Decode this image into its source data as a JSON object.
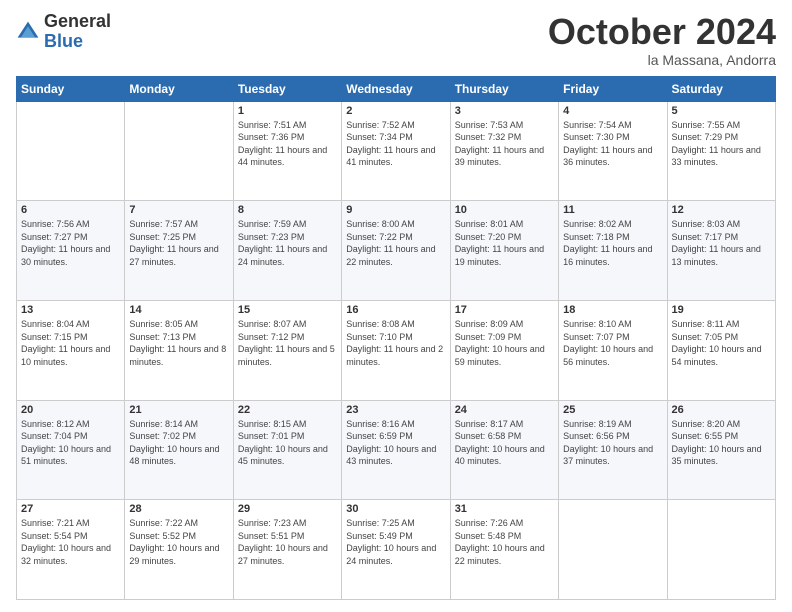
{
  "header": {
    "logo_general": "General",
    "logo_blue": "Blue",
    "month_title": "October 2024",
    "location": "la Massana, Andorra"
  },
  "days_of_week": [
    "Sunday",
    "Monday",
    "Tuesday",
    "Wednesday",
    "Thursday",
    "Friday",
    "Saturday"
  ],
  "weeks": [
    [
      {
        "day": "",
        "info": ""
      },
      {
        "day": "",
        "info": ""
      },
      {
        "day": "1",
        "info": "Sunrise: 7:51 AM\nSunset: 7:36 PM\nDaylight: 11 hours and 44 minutes."
      },
      {
        "day": "2",
        "info": "Sunrise: 7:52 AM\nSunset: 7:34 PM\nDaylight: 11 hours and 41 minutes."
      },
      {
        "day": "3",
        "info": "Sunrise: 7:53 AM\nSunset: 7:32 PM\nDaylight: 11 hours and 39 minutes."
      },
      {
        "day": "4",
        "info": "Sunrise: 7:54 AM\nSunset: 7:30 PM\nDaylight: 11 hours and 36 minutes."
      },
      {
        "day": "5",
        "info": "Sunrise: 7:55 AM\nSunset: 7:29 PM\nDaylight: 11 hours and 33 minutes."
      }
    ],
    [
      {
        "day": "6",
        "info": "Sunrise: 7:56 AM\nSunset: 7:27 PM\nDaylight: 11 hours and 30 minutes."
      },
      {
        "day": "7",
        "info": "Sunrise: 7:57 AM\nSunset: 7:25 PM\nDaylight: 11 hours and 27 minutes."
      },
      {
        "day": "8",
        "info": "Sunrise: 7:59 AM\nSunset: 7:23 PM\nDaylight: 11 hours and 24 minutes."
      },
      {
        "day": "9",
        "info": "Sunrise: 8:00 AM\nSunset: 7:22 PM\nDaylight: 11 hours and 22 minutes."
      },
      {
        "day": "10",
        "info": "Sunrise: 8:01 AM\nSunset: 7:20 PM\nDaylight: 11 hours and 19 minutes."
      },
      {
        "day": "11",
        "info": "Sunrise: 8:02 AM\nSunset: 7:18 PM\nDaylight: 11 hours and 16 minutes."
      },
      {
        "day": "12",
        "info": "Sunrise: 8:03 AM\nSunset: 7:17 PM\nDaylight: 11 hours and 13 minutes."
      }
    ],
    [
      {
        "day": "13",
        "info": "Sunrise: 8:04 AM\nSunset: 7:15 PM\nDaylight: 11 hours and 10 minutes."
      },
      {
        "day": "14",
        "info": "Sunrise: 8:05 AM\nSunset: 7:13 PM\nDaylight: 11 hours and 8 minutes."
      },
      {
        "day": "15",
        "info": "Sunrise: 8:07 AM\nSunset: 7:12 PM\nDaylight: 11 hours and 5 minutes."
      },
      {
        "day": "16",
        "info": "Sunrise: 8:08 AM\nSunset: 7:10 PM\nDaylight: 11 hours and 2 minutes."
      },
      {
        "day": "17",
        "info": "Sunrise: 8:09 AM\nSunset: 7:09 PM\nDaylight: 10 hours and 59 minutes."
      },
      {
        "day": "18",
        "info": "Sunrise: 8:10 AM\nSunset: 7:07 PM\nDaylight: 10 hours and 56 minutes."
      },
      {
        "day": "19",
        "info": "Sunrise: 8:11 AM\nSunset: 7:05 PM\nDaylight: 10 hours and 54 minutes."
      }
    ],
    [
      {
        "day": "20",
        "info": "Sunrise: 8:12 AM\nSunset: 7:04 PM\nDaylight: 10 hours and 51 minutes."
      },
      {
        "day": "21",
        "info": "Sunrise: 8:14 AM\nSunset: 7:02 PM\nDaylight: 10 hours and 48 minutes."
      },
      {
        "day": "22",
        "info": "Sunrise: 8:15 AM\nSunset: 7:01 PM\nDaylight: 10 hours and 45 minutes."
      },
      {
        "day": "23",
        "info": "Sunrise: 8:16 AM\nSunset: 6:59 PM\nDaylight: 10 hours and 43 minutes."
      },
      {
        "day": "24",
        "info": "Sunrise: 8:17 AM\nSunset: 6:58 PM\nDaylight: 10 hours and 40 minutes."
      },
      {
        "day": "25",
        "info": "Sunrise: 8:19 AM\nSunset: 6:56 PM\nDaylight: 10 hours and 37 minutes."
      },
      {
        "day": "26",
        "info": "Sunrise: 8:20 AM\nSunset: 6:55 PM\nDaylight: 10 hours and 35 minutes."
      }
    ],
    [
      {
        "day": "27",
        "info": "Sunrise: 7:21 AM\nSunset: 5:54 PM\nDaylight: 10 hours and 32 minutes."
      },
      {
        "day": "28",
        "info": "Sunrise: 7:22 AM\nSunset: 5:52 PM\nDaylight: 10 hours and 29 minutes."
      },
      {
        "day": "29",
        "info": "Sunrise: 7:23 AM\nSunset: 5:51 PM\nDaylight: 10 hours and 27 minutes."
      },
      {
        "day": "30",
        "info": "Sunrise: 7:25 AM\nSunset: 5:49 PM\nDaylight: 10 hours and 24 minutes."
      },
      {
        "day": "31",
        "info": "Sunrise: 7:26 AM\nSunset: 5:48 PM\nDaylight: 10 hours and 22 minutes."
      },
      {
        "day": "",
        "info": ""
      },
      {
        "day": "",
        "info": ""
      }
    ]
  ]
}
